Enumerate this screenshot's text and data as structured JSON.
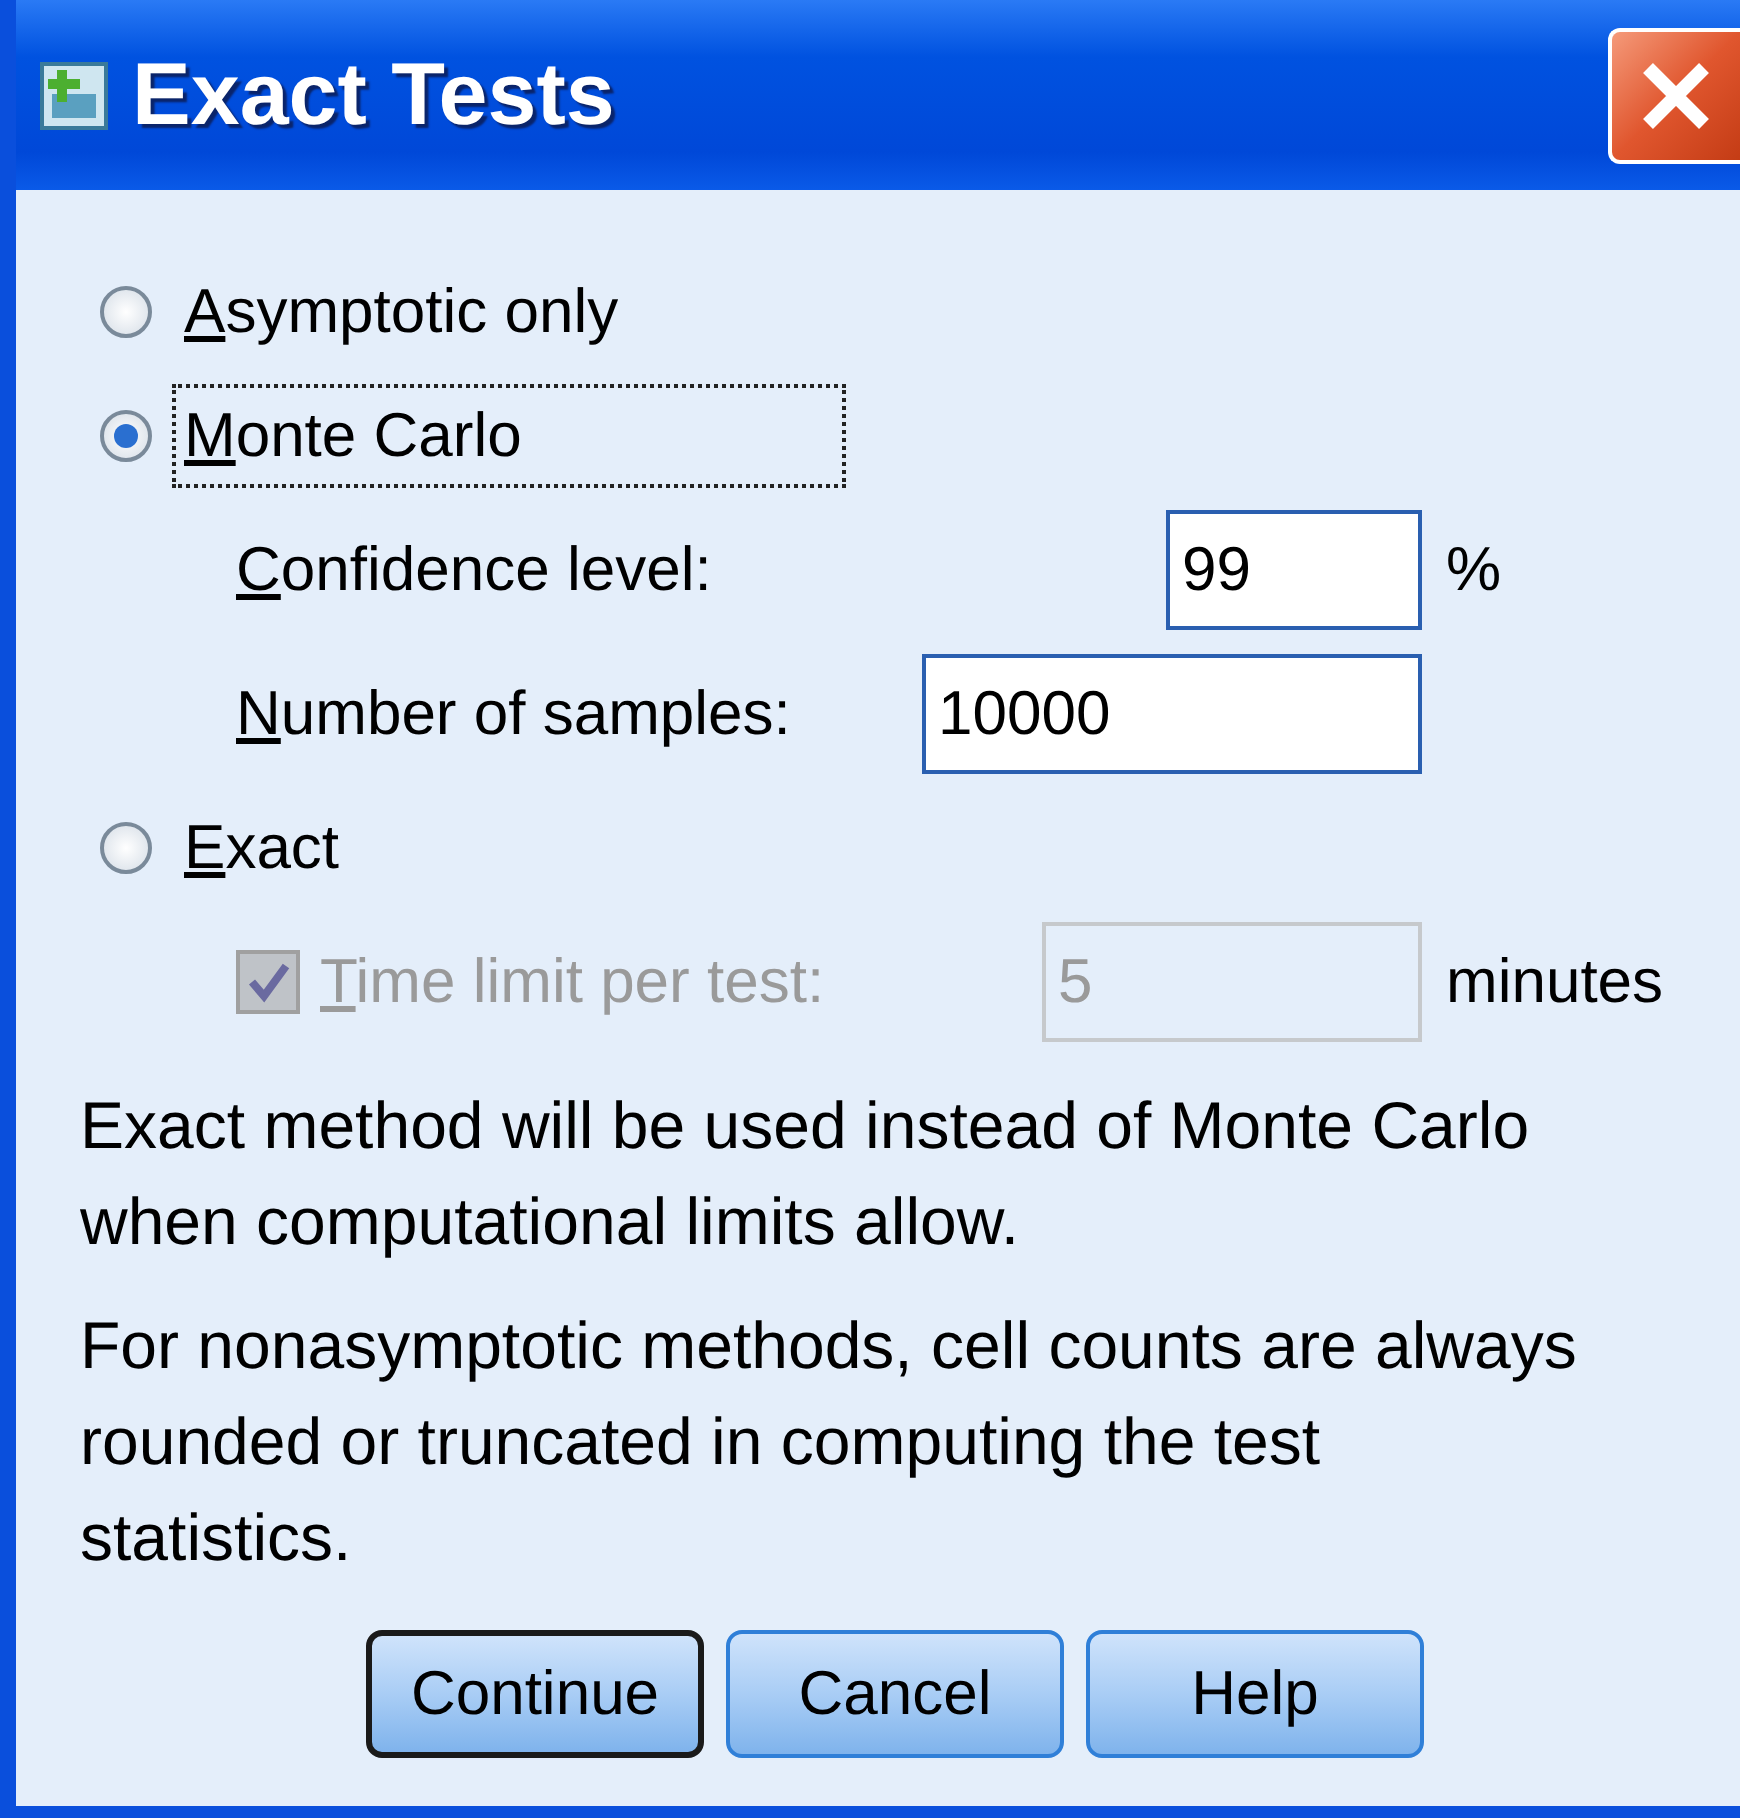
{
  "window": {
    "title": "Exact Tests"
  },
  "options": [
    {
      "label": "Asymptotic only",
      "selected": false,
      "focused": false,
      "underline_first": true
    },
    {
      "label": "Monte Carlo",
      "selected": true,
      "focused": true,
      "underline_first": true,
      "fields": [
        {
          "label": "Confidence level:",
          "underline_first": true,
          "value": "99",
          "unit": "%"
        },
        {
          "label": "Number of samples:",
          "underline_first": true,
          "value": "10000"
        }
      ]
    },
    {
      "label": "Exact",
      "selected": false,
      "focused": false,
      "underline_first": true,
      "time_limit": {
        "label": "Time limit per test:",
        "underline_first": true,
        "checked": true,
        "disabled": true,
        "value": "5",
        "unit": "minutes"
      }
    }
  ],
  "notes": [
    "Exact method will be used instead of Monte Carlo when computational limits allow.",
    "For nonasymptotic methods, cell counts are always rounded or truncated in computing the test statistics."
  ],
  "buttons": [
    {
      "label": "Continue",
      "default": true
    },
    {
      "label": "Cancel",
      "default": false
    },
    {
      "label": "Help",
      "default": false
    }
  ]
}
